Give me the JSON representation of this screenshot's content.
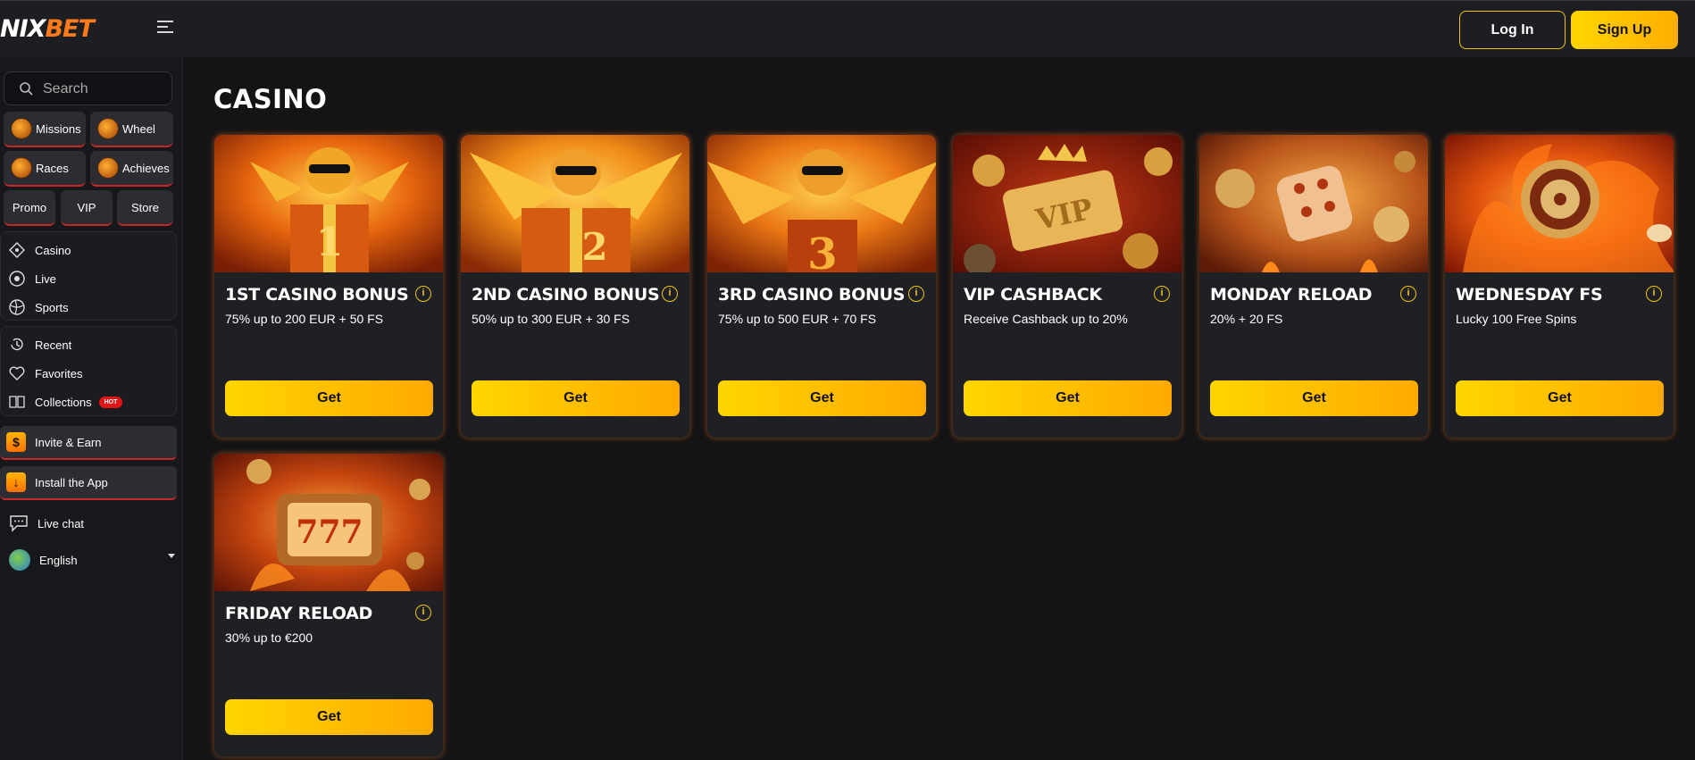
{
  "brand": {
    "logo_left": "NIX",
    "logo_right": "BET"
  },
  "header": {
    "login_label": "Log In",
    "signup_label": "Sign Up"
  },
  "sidebar": {
    "search_placeholder": "Search",
    "chips": [
      "Missions",
      "Wheel",
      "Races",
      "Achieves",
      "Promo",
      "VIP",
      "Store"
    ],
    "nav_main": [
      "Casino",
      "Live",
      "Sports"
    ],
    "nav_personal": [
      "Recent",
      "Favorites",
      "Collections"
    ],
    "hot_badge": "HOT",
    "invite": "Invite & Earn",
    "install": "Install the App",
    "live_chat": "Live chat",
    "language": "English"
  },
  "main": {
    "title": "CASINO",
    "info_symbol": "i",
    "get_label": "Get",
    "cards": [
      {
        "title": "1ST CASINO BONUS",
        "desc": "75% up to 200 EUR + 50 FS"
      },
      {
        "title": "2ND CASINO BONUS",
        "desc": "50% up to 300 EUR + 30 FS"
      },
      {
        "title": "3RD CASINO BONUS",
        "desc": "75% up to 500 EUR + 70 FS"
      },
      {
        "title": "VIP CASHBACK",
        "desc": "Receive Cashback up to 20%"
      },
      {
        "title": "MONDAY RELOAD",
        "desc": "20% + 20 FS"
      },
      {
        "title": "WEDNESDAY FS",
        "desc": "Lucky 100 Free Spins"
      },
      {
        "title": "FRIDAY RELOAD",
        "desc": "30% up to €200"
      }
    ],
    "art_labels": [
      "1",
      "2",
      "3",
      "VIP",
      "777"
    ]
  },
  "colors": {
    "accent": "#ffc400",
    "accent_dark": "#ffa900",
    "bg": "#141416",
    "alert": "#c72727"
  }
}
